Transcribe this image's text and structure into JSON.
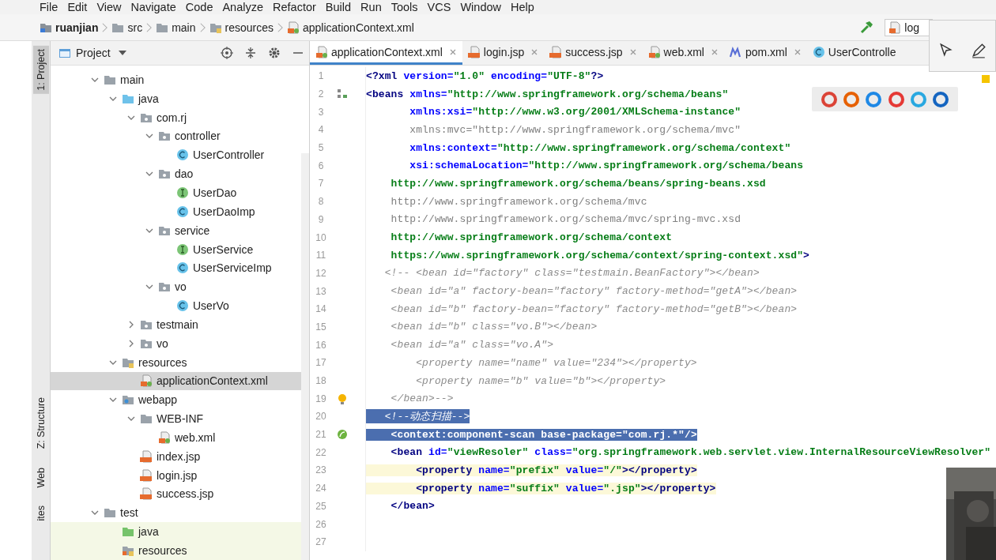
{
  "menu": [
    "File",
    "Edit",
    "View",
    "Navigate",
    "Code",
    "Analyze",
    "Refactor",
    "Build",
    "Run",
    "Tools",
    "VCS",
    "Window",
    "Help"
  ],
  "breadcrumbs": [
    {
      "label": "ruanjian",
      "kind": "module"
    },
    {
      "label": "src",
      "kind": "folder"
    },
    {
      "label": "main",
      "kind": "folder"
    },
    {
      "label": "resources",
      "kind": "resources"
    },
    {
      "label": "applicationContext.xml",
      "kind": "xml"
    }
  ],
  "run_field": {
    "value": "log"
  },
  "side_stripe": [
    {
      "label": "1: Project",
      "selected": true
    },
    {
      "label": "Z: Structure",
      "selected": false
    },
    {
      "label": "Web",
      "selected": false
    },
    {
      "label": "ites",
      "selected": false
    }
  ],
  "project_panel": {
    "title": "Project"
  },
  "tree": [
    {
      "label": "main",
      "kind": "folder",
      "expanded": true,
      "selected": false,
      "children": [
        {
          "label": "java",
          "kind": "source",
          "expanded": true,
          "selected": false,
          "children": [
            {
              "label": "com.rj",
              "kind": "package",
              "expanded": true,
              "selected": false,
              "children": [
                {
                  "label": "controller",
                  "kind": "package",
                  "expanded": true,
                  "selected": false,
                  "children": [
                    {
                      "label": "UserController",
                      "kind": "class",
                      "selected": false
                    }
                  ]
                },
                {
                  "label": "dao",
                  "kind": "package",
                  "expanded": true,
                  "selected": false,
                  "children": [
                    {
                      "label": "UserDao",
                      "kind": "interface",
                      "selected": false
                    },
                    {
                      "label": "UserDaoImp",
                      "kind": "class",
                      "selected": false
                    }
                  ]
                },
                {
                  "label": "service",
                  "kind": "package",
                  "expanded": true,
                  "selected": false,
                  "children": [
                    {
                      "label": "UserService",
                      "kind": "interface",
                      "selected": false
                    },
                    {
                      "label": "UserServiceImp",
                      "kind": "class",
                      "selected": false
                    }
                  ]
                },
                {
                  "label": "vo",
                  "kind": "package",
                  "expanded": true,
                  "selected": false,
                  "children": [
                    {
                      "label": "UserVo",
                      "kind": "class",
                      "selected": false
                    }
                  ]
                }
              ]
            },
            {
              "label": "testmain",
              "kind": "package",
              "expanded": false,
              "selected": false
            },
            {
              "label": "vo",
              "kind": "package",
              "expanded": false,
              "selected": false
            }
          ]
        },
        {
          "label": "resources",
          "kind": "resources",
          "expanded": true,
          "selected": false,
          "children": [
            {
              "label": "applicationContext.xml",
              "kind": "xml",
              "selected": true
            }
          ]
        },
        {
          "label": "webapp",
          "kind": "webapp",
          "expanded": true,
          "selected": false,
          "children": [
            {
              "label": "WEB-INF",
              "kind": "folder",
              "expanded": true,
              "selected": false,
              "children": [
                {
                  "label": "web.xml",
                  "kind": "xml",
                  "selected": false
                }
              ]
            },
            {
              "label": "index.jsp",
              "kind": "jsp",
              "selected": false
            },
            {
              "label": "login.jsp",
              "kind": "jsp",
              "selected": false
            },
            {
              "label": "success.jsp",
              "kind": "jsp",
              "selected": false
            }
          ]
        }
      ]
    },
    {
      "label": "test",
      "kind": "folder",
      "expanded": true,
      "selected": false,
      "children": [
        {
          "label": "java",
          "kind": "test-source",
          "selected": false
        },
        {
          "label": "resources",
          "kind": "test-resources",
          "selected": false
        }
      ]
    }
  ],
  "tabs": [
    {
      "label": "applicationContext.xml",
      "kind": "xml",
      "selected": true
    },
    {
      "label": "login.jsp",
      "kind": "jsp",
      "selected": false
    },
    {
      "label": "success.jsp",
      "kind": "jsp",
      "selected": false
    },
    {
      "label": "web.xml",
      "kind": "xml",
      "selected": false
    },
    {
      "label": "pom.xml",
      "kind": "maven",
      "selected": false
    },
    {
      "label": "UserControlle",
      "kind": "class",
      "selected": false
    }
  ],
  "code": [
    {
      "number": "1",
      "kind": "normal",
      "segments": [
        {
          "kind": "tag",
          "text": "<?xml "
        },
        {
          "kind": "attr",
          "text": "version="
        },
        {
          "kind": "value",
          "text": "\"1.0\""
        },
        {
          "kind": "attr",
          "text": " encoding="
        },
        {
          "kind": "value",
          "text": "\"UTF-8\""
        },
        {
          "kind": "tag",
          "text": "?>"
        }
      ]
    },
    {
      "number": "2",
      "kind": "normal",
      "gutter": {
        "kind": "bean"
      },
      "segments": [
        {
          "kind": "tag",
          "text": "<beans "
        },
        {
          "kind": "attr",
          "text": "xmlns="
        },
        {
          "kind": "value",
          "text": "\"http://www.springframework.org/schema/beans\""
        }
      ]
    },
    {
      "number": "3",
      "kind": "normal",
      "segments": [
        {
          "kind": "attr",
          "text": "       xmlns:xsi="
        },
        {
          "kind": "value",
          "text": "\"http://www.w3.org/2001/XMLSchema-instance\""
        }
      ]
    },
    {
      "number": "4",
      "kind": "normal",
      "segments": [
        {
          "kind": "dim",
          "text": "       xmlns:mvc=\"http://www.springframework.org/schema/mvc\""
        }
      ]
    },
    {
      "number": "5",
      "kind": "normal",
      "segments": [
        {
          "kind": "attr",
          "text": "       xmlns:context="
        },
        {
          "kind": "value",
          "text": "\"http://www.springframework.org/schema/context\""
        }
      ]
    },
    {
      "number": "6",
      "kind": "normal",
      "segments": [
        {
          "kind": "attr",
          "text": "       xsi:schemaLocation="
        },
        {
          "kind": "value",
          "text": "\"http://www.springframework.org/schema/beans"
        }
      ]
    },
    {
      "number": "7",
      "kind": "normal",
      "segments": [
        {
          "kind": "value",
          "text": "    http://www.springframework.org/schema/beans/spring-beans.xsd"
        }
      ]
    },
    {
      "number": "8",
      "kind": "normal",
      "segments": [
        {
          "kind": "dim",
          "text": "    http://www.springframework.org/schema/mvc"
        }
      ]
    },
    {
      "number": "9",
      "kind": "normal",
      "segments": [
        {
          "kind": "dim",
          "text": "    http://www.springframework.org/schema/mvc/spring-mvc.xsd"
        }
      ]
    },
    {
      "number": "10",
      "kind": "normal",
      "segments": [
        {
          "kind": "value",
          "text": "    http://www.springframework.org/schema/context"
        }
      ]
    },
    {
      "number": "11",
      "kind": "normal",
      "segments": [
        {
          "kind": "value",
          "text": "    https://www.springframework.org/schema/context/spring-context.xsd\""
        },
        {
          "kind": "tag",
          "text": ">"
        }
      ]
    },
    {
      "number": "12",
      "kind": "normal",
      "segments": [
        {
          "kind": "comment",
          "text": "   <!-- <bean id=\"factory\" class=\"testmain.BeanFactory\"></bean>"
        }
      ]
    },
    {
      "number": "13",
      "kind": "normal",
      "segments": [
        {
          "kind": "comment",
          "text": "    <bean id=\"a\" factory-bean=\"factory\" factory-method=\"getA\"></bean>"
        }
      ]
    },
    {
      "number": "14",
      "kind": "normal",
      "segments": [
        {
          "kind": "comment",
          "text": "    <bean id=\"b\" factory-bean=\"factory\" factory-method=\"getB\"></bean>"
        }
      ]
    },
    {
      "number": "15",
      "kind": "normal",
      "segments": [
        {
          "kind": "comment",
          "text": "    <bean id=\"b\" class=\"vo.B\"></bean>"
        }
      ]
    },
    {
      "number": "16",
      "kind": "normal",
      "segments": [
        {
          "kind": "comment",
          "text": "    <bean id=\"a\" class=\"vo.A\">"
        }
      ]
    },
    {
      "number": "17",
      "kind": "normal",
      "segments": [
        {
          "kind": "comment",
          "text": "        <property name=\"name\" value=\"234\"></property>"
        }
      ]
    },
    {
      "number": "18",
      "kind": "normal",
      "segments": [
        {
          "kind": "comment",
          "text": "        <property name=\"b\" value=\"b\"></property>"
        }
      ]
    },
    {
      "number": "19",
      "kind": "normal",
      "gutter": {
        "kind": "bulb"
      },
      "segments": [
        {
          "kind": "comment",
          "text": "    </bean>-->"
        }
      ]
    },
    {
      "number": "20",
      "kind": "selected",
      "segments": [
        {
          "kind": "comment",
          "text": "   <!--动态扫描-->"
        }
      ]
    },
    {
      "number": "21",
      "kind": "selected",
      "gutter": {
        "kind": "spring"
      },
      "segments": [
        {
          "kind": "tag",
          "text": "    <context:component-scan "
        },
        {
          "kind": "attr",
          "text": "base-package="
        },
        {
          "kind": "value",
          "text": "\"com.rj.*\""
        },
        {
          "kind": "tag",
          "text": "/>"
        }
      ]
    },
    {
      "number": "22",
      "kind": "normal",
      "segments": [
        {
          "kind": "tag",
          "text": "    <bean "
        },
        {
          "kind": "attr",
          "text": "id="
        },
        {
          "kind": "value",
          "text": "\"viewResoler\""
        },
        {
          "kind": "attr",
          "text": " class="
        },
        {
          "kind": "value",
          "text": "\"org.springframework.web.servlet.view.InternalResourceViewResolver\""
        }
      ]
    },
    {
      "number": "23",
      "kind": "highlighted",
      "segments": [
        {
          "kind": "tag",
          "text": "        <property "
        },
        {
          "kind": "attr",
          "text": "name="
        },
        {
          "kind": "value",
          "text": "\"prefix\""
        },
        {
          "kind": "attr",
          "text": " value="
        },
        {
          "kind": "value",
          "text": "\"/\""
        },
        {
          "kind": "tag",
          "text": "></property>"
        }
      ]
    },
    {
      "number": "24",
      "kind": "highlighted",
      "segments": [
        {
          "kind": "tag",
          "text": "        <property "
        },
        {
          "kind": "attr",
          "text": "name="
        },
        {
          "kind": "value",
          "text": "\"suffix\""
        },
        {
          "kind": "attr",
          "text": " value="
        },
        {
          "kind": "value",
          "text": "\".jsp\""
        },
        {
          "kind": "tag",
          "text": "></property>"
        }
      ]
    },
    {
      "number": "25",
      "kind": "normal",
      "segments": [
        {
          "kind": "tag",
          "text": "    </bean>"
        }
      ]
    },
    {
      "number": "26",
      "kind": "normal"
    },
    {
      "number": "27",
      "kind": "normal"
    }
  ]
}
